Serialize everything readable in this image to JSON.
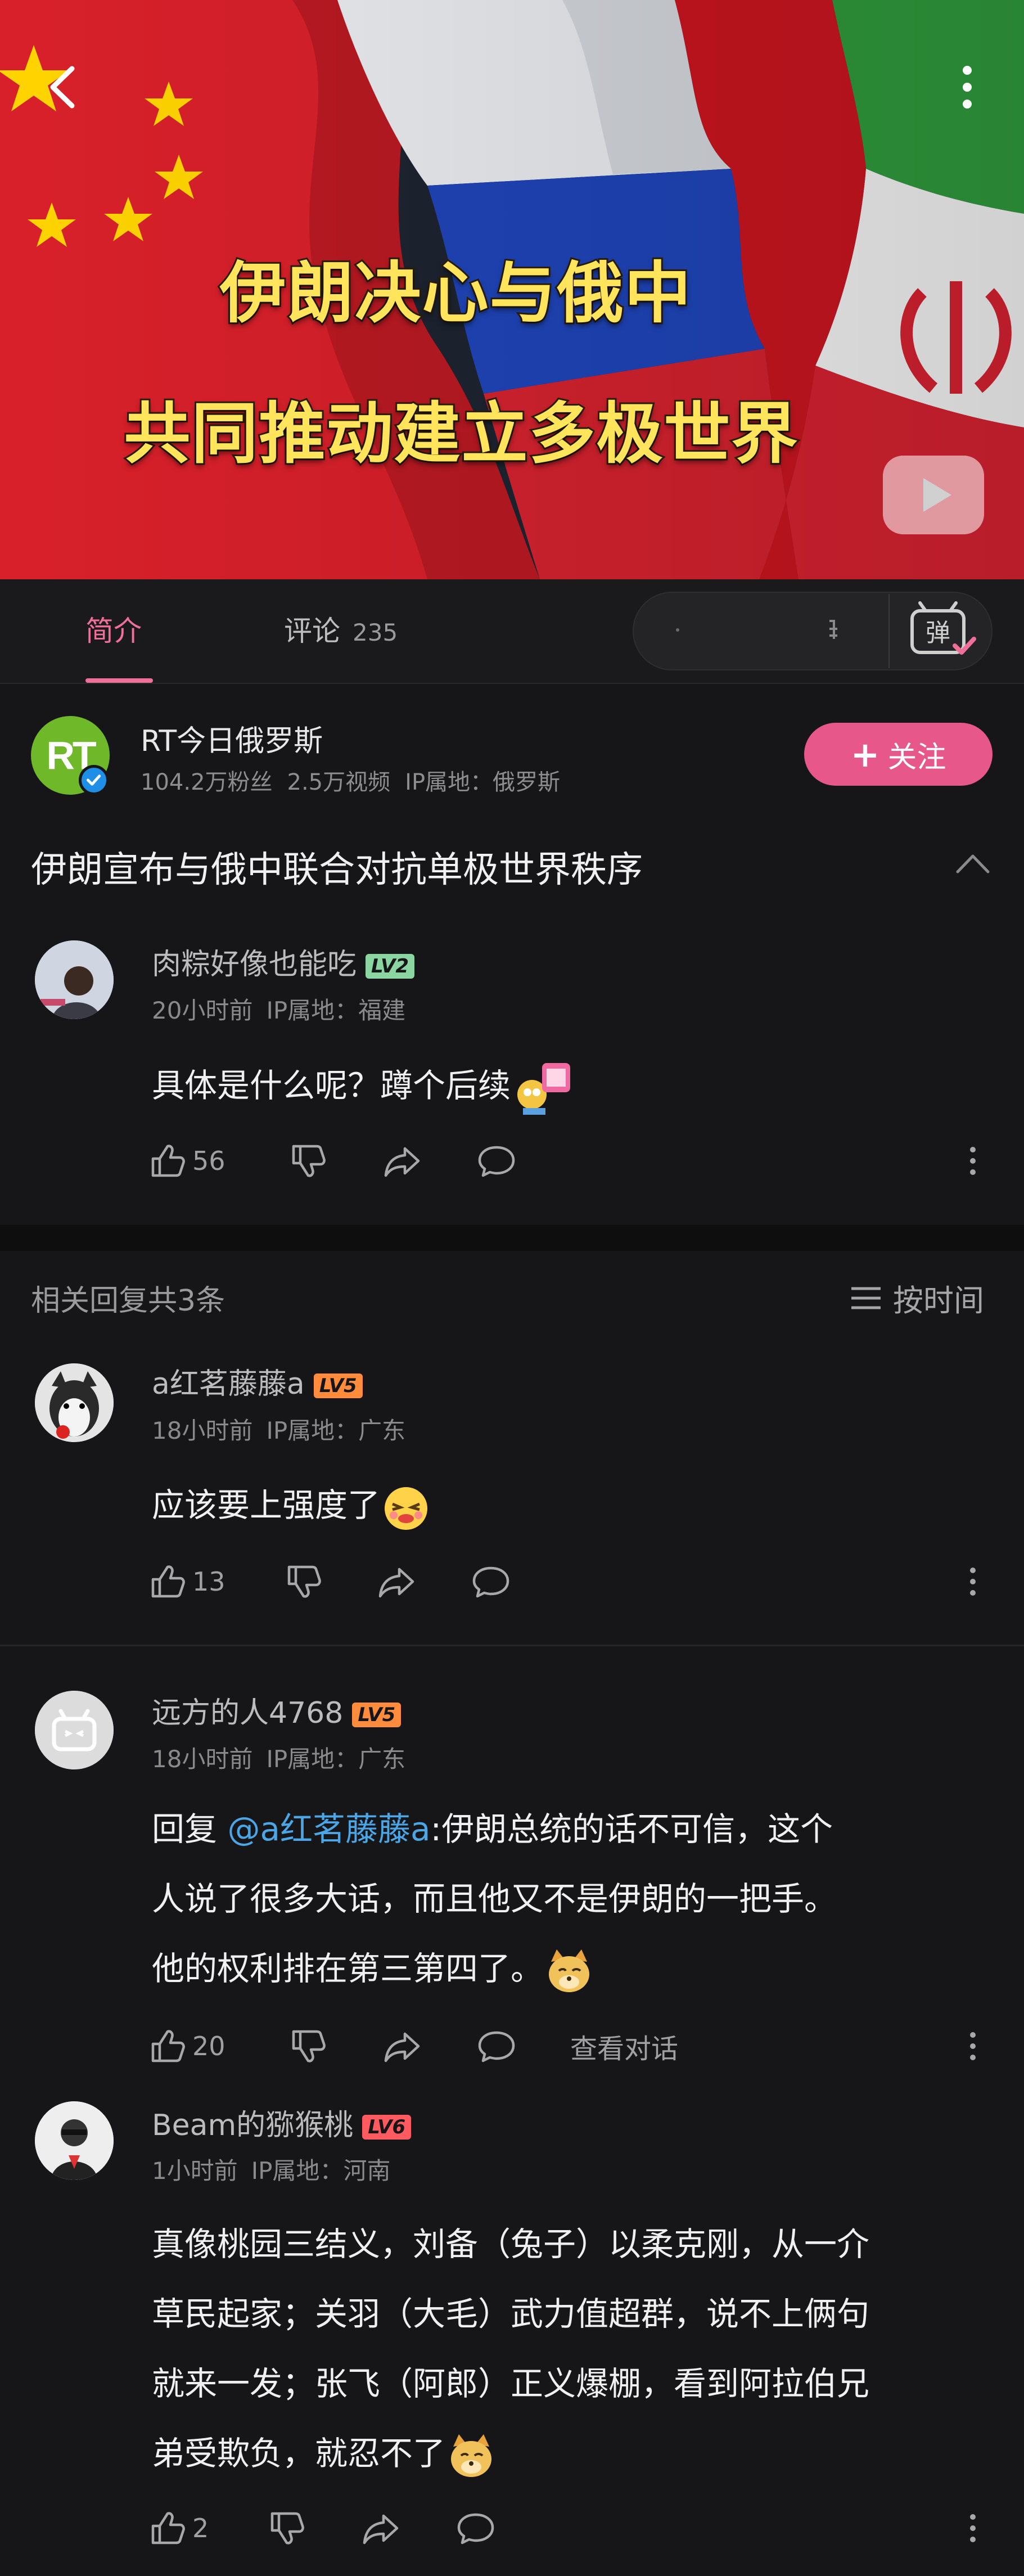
{
  "video": {
    "title_line1": "伊朗决心与俄中",
    "title_line2": "共同推动建立多极世界",
    "flags": [
      "china-flag",
      "russia-flag",
      "iran-flag"
    ]
  },
  "tabs": {
    "intro": "简介",
    "comments": "评论",
    "comment_count": "235",
    "danmaku_toggle": "弹"
  },
  "uploader": {
    "name": "RT今日俄罗斯",
    "logo_text": "RT",
    "fans": "104.2万粉丝",
    "videos": "2.5万视频",
    "ip": "IP属地：俄罗斯",
    "follow_label": "关注"
  },
  "video_title": "伊朗宣布与俄中联合对抗单极世界秩序",
  "main_comment": {
    "user": "肉粽好像也能吃",
    "level": "LV2",
    "time": "20小时前",
    "ip": "IP属地：福建",
    "text": "具体是什么呢？蹲个后续",
    "likes": "56"
  },
  "replies_header": {
    "label": "相关回复共3条",
    "sort_label": "按时间"
  },
  "replies": [
    {
      "user": "a红茗藤藤a",
      "level": "LV5",
      "time": "18小时前",
      "ip": "IP属地：广东",
      "text": "应该要上强度了",
      "likes": "13"
    },
    {
      "user": "远方的人4768",
      "level": "LV5",
      "time": "18小时前",
      "ip": "IP属地：广东",
      "reply_prefix": "回复 ",
      "mention": "@a红茗藤藤a",
      "text_lines": [
        ":伊朗总统的话不可信，这个",
        "人说了很多大话，而且他又不是伊朗的一把手。",
        "他的权利排在第三第四了。"
      ],
      "likes": "20",
      "view_dialog": "查看对话"
    },
    {
      "user": "Beam的猕猴桃",
      "level": "LV6",
      "time": "1小时前",
      "ip": "IP属地：河南",
      "text_lines": [
        "真像桃园三结义，刘备（兔子）以柔克刚，从一介",
        "草民起家；关羽（大毛）武力值超群，说不上俩句",
        "就来一发；张飞（阿郎）正义爆棚，看到阿拉伯兄",
        "弟受欺负，就忍不了"
      ],
      "likes": "2"
    }
  ],
  "colors": {
    "accent_pink": "#f06f98",
    "follow_bg": "#e8578a",
    "mention_blue": "#4ba6e8",
    "background": "#161618"
  }
}
